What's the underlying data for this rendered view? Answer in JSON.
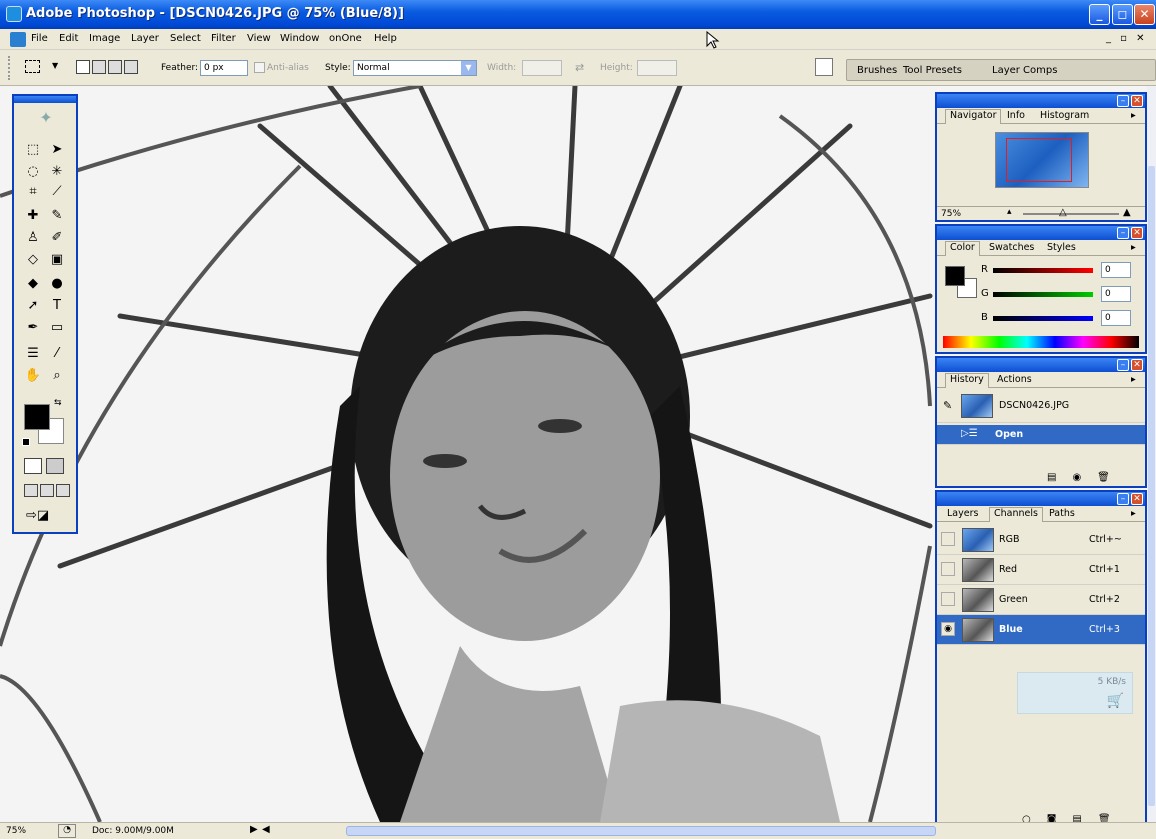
{
  "window": {
    "title": "Adobe Photoshop - [DSCN0426.JPG @ 75% (Blue/8)]",
    "min_label": "_",
    "max_label": "◻",
    "close_label": "✕"
  },
  "menu": {
    "items": [
      "File",
      "Edit",
      "Image",
      "Layer",
      "Select",
      "Filter",
      "View",
      "Window",
      "onOne",
      "Help"
    ],
    "doc_controls": "_ ▫ ✕"
  },
  "options": {
    "feather_label": "Feather:",
    "feather_value": "0 px",
    "antialias_label": "Anti-alias",
    "style_label": "Style:",
    "style_value": "Normal",
    "width_label": "Width:",
    "height_label": "Height:",
    "well_tabs": [
      "Brushes",
      "Tool Presets",
      "Layer Comps"
    ]
  },
  "toolbox": {
    "tools": [
      [
        "marquee-tool",
        "⬚"
      ],
      [
        "move-tool",
        "➤"
      ],
      [
        "lasso-tool",
        "◌"
      ],
      [
        "magic-wand-tool",
        "✳"
      ],
      [
        "crop-tool",
        "⌗"
      ],
      [
        "slice-tool",
        "⟋"
      ],
      [
        "healing-tool",
        "✚"
      ],
      [
        "brush-tool",
        "✎"
      ],
      [
        "stamp-tool",
        "♙"
      ],
      [
        "history-brush-tool",
        "✐"
      ],
      [
        "eraser-tool",
        "◇"
      ],
      [
        "gradient-tool",
        "▣"
      ],
      [
        "blur-tool",
        "◆"
      ],
      [
        "dodge-tool",
        "●"
      ],
      [
        "path-select-tool",
        "➚"
      ],
      [
        "type-tool",
        "T"
      ],
      [
        "pen-tool",
        "✒"
      ],
      [
        "shape-tool",
        "▭"
      ],
      [
        "notes-tool",
        "☰"
      ],
      [
        "eyedropper-tool",
        "⁄"
      ],
      [
        "hand-tool",
        "✋"
      ],
      [
        "zoom-tool",
        "⌕"
      ]
    ],
    "foreground_color": "#000000",
    "background_color": "#ffffff"
  },
  "navigator": {
    "tabs": [
      "Navigator",
      "Info",
      "Histogram"
    ],
    "zoom": "75%"
  },
  "color": {
    "tabs": [
      "Color",
      "Swatches",
      "Styles"
    ],
    "channels": [
      {
        "label": "R",
        "value": "0"
      },
      {
        "label": "G",
        "value": "0"
      },
      {
        "label": "B",
        "value": "0"
      }
    ]
  },
  "history": {
    "tabs": [
      "History",
      "Actions"
    ],
    "snapshot": "DSCN0426.JPG",
    "steps": [
      "Open"
    ]
  },
  "channels": {
    "tabs": [
      "Layers",
      "Channels",
      "Paths"
    ],
    "rows": [
      {
        "name": "RGB",
        "shortcut": "Ctrl+~"
      },
      {
        "name": "Red",
        "shortcut": "Ctrl+1"
      },
      {
        "name": "Green",
        "shortcut": "Ctrl+2"
      },
      {
        "name": "Blue",
        "shortcut": "Ctrl+3"
      }
    ],
    "selected": "Blue"
  },
  "download_widget": {
    "speed": "5 KB/s"
  },
  "status": {
    "zoom": "75%",
    "doc": "Doc: 9.00M/9.00M"
  }
}
